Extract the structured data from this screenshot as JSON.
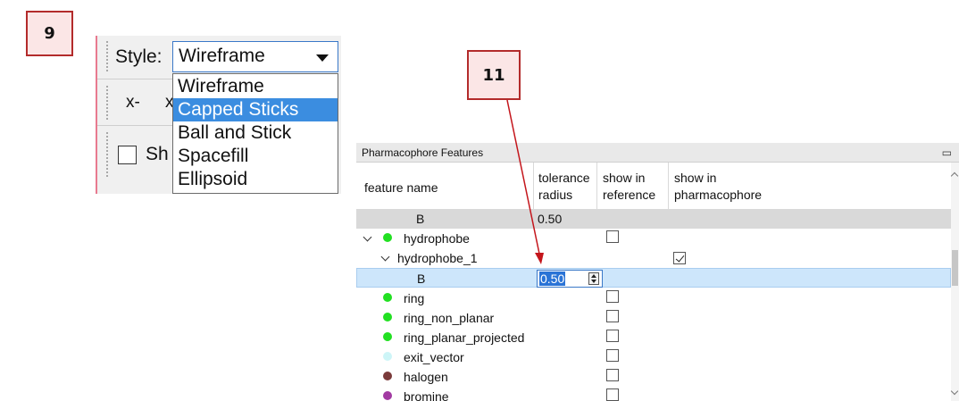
{
  "badges": {
    "step_9": "9",
    "step_11": "11"
  },
  "style_toolbar": {
    "style_label": "Style:",
    "style_value": "Wireframe",
    "options": [
      "Wireframe",
      "Capped Sticks",
      "Ball and Stick",
      "Spacefill",
      "Ellipsoid"
    ],
    "highlighted_option": "Capped Sticks",
    "row2_label": "x-",
    "row2_partial": "x",
    "row3_partial": "Sh"
  },
  "pharmacophore_panel": {
    "title": "Pharmacophore Features",
    "float_icon": "restore-window-icon",
    "columns": {
      "feature_name": "feature name",
      "tolerance_line1": "tolerance",
      "tolerance_line2": "radius",
      "show_ref_line1": "show in",
      "show_ref_line2": "reference",
      "show_pharm_line1": "show in",
      "show_pharm_line2": "pharmacophore"
    },
    "rows": {
      "r0": {
        "name": "B",
        "tolerance": "0.50"
      },
      "r1": {
        "name": "hydrophobe",
        "color": "#22e022"
      },
      "r2": {
        "name": "hydrophobe_1"
      },
      "r3": {
        "name": "B",
        "tolerance": "0.50"
      },
      "r4": {
        "name": "ring",
        "color": "#22e022"
      },
      "r5": {
        "name": "ring_non_planar",
        "color": "#22e022"
      },
      "r6": {
        "name": "ring_planar_projected",
        "color": "#22e022"
      },
      "r7": {
        "name": "exit_vector",
        "color": "#cdf5f7"
      },
      "r8": {
        "name": "halogen",
        "color": "#7a3a3a"
      },
      "r9": {
        "name": "bromine",
        "color": "#a23aa2"
      }
    }
  },
  "colors": {
    "accent": "#3b8de0",
    "badge_border": "#b32b2b",
    "badge_fill": "#fbe6e6",
    "arrow": "#c4161c",
    "selected_row": "#cde6fb",
    "gray_row": "#d9d9d9"
  }
}
